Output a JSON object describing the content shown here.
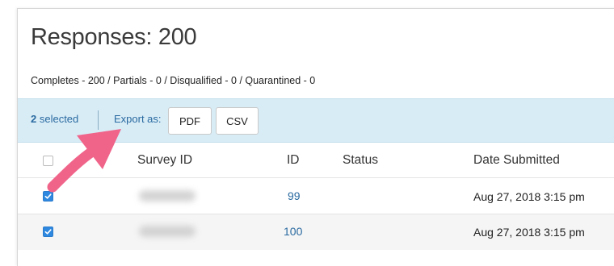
{
  "page": {
    "title": "Responses: 200",
    "summary": "Completes - 200 / Partials - 0 / Disqualified - 0 / Quarantined - 0"
  },
  "action_bar": {
    "selected_count": "2",
    "selected_suffix": " selected",
    "export_label": "Export as:",
    "pdf_label": "PDF",
    "csv_label": "CSV"
  },
  "table": {
    "headers": [
      "Survey ID",
      "ID",
      "Status",
      "Date Submitted"
    ],
    "rows": [
      {
        "id": "99",
        "date": "Aug 27, 2018 3:15 pm",
        "checked": true
      },
      {
        "id": "100",
        "date": "Aug 27, 2018 3:15 pm",
        "checked": true
      }
    ]
  },
  "colors": {
    "accent": "#2a6aa0",
    "checkbox": "#2f88e0",
    "bar_bg": "#d8ecf6",
    "arrow": "#f0648a"
  },
  "icons": [
    "checkbox-empty-icon",
    "checkbox-checked-icon",
    "pointer-arrow-icon"
  ]
}
